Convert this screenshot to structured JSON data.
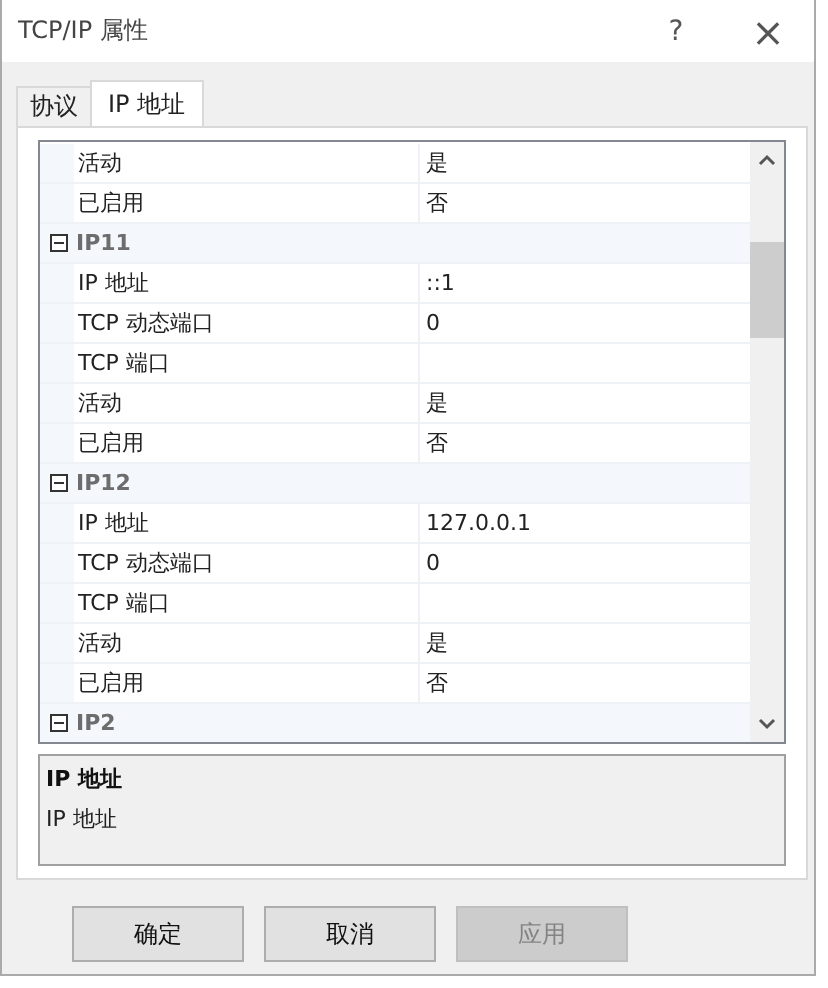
{
  "window": {
    "title": "TCP/IP 属性",
    "help": "?",
    "close": "×"
  },
  "tabs": [
    {
      "label": "协议",
      "selected": false
    },
    {
      "label": "IP 地址",
      "selected": true
    }
  ],
  "property_grid": {
    "groups": [
      {
        "properties": [
          {
            "name": "活动",
            "value": "是"
          },
          {
            "name": "已启用",
            "value": "否"
          }
        ]
      },
      {
        "name": "IP11",
        "expanded": true,
        "properties": [
          {
            "name": "IP 地址",
            "value": "::1"
          },
          {
            "name": "TCP 动态端口",
            "value": "0"
          },
          {
            "name": "TCP 端口"
          },
          {
            "name": "活动",
            "value": "是"
          },
          {
            "name": "已启用",
            "value": "否"
          }
        ]
      },
      {
        "name": "IP12",
        "expanded": true,
        "properties": [
          {
            "name": "IP 地址",
            "value": "127.0.0.1"
          },
          {
            "name": "TCP 动态端口",
            "value": "0"
          },
          {
            "name": "TCP 端口"
          },
          {
            "name": "活动",
            "value": "是"
          },
          {
            "name": "已启用",
            "value": "否"
          }
        ]
      },
      {
        "name": "IP2",
        "expanded": true
      }
    ]
  },
  "description": {
    "title": "IP 地址",
    "text": "IP 地址"
  },
  "buttons": [
    {
      "label": "确定",
      "disabled": false
    },
    {
      "label": "取消",
      "disabled": false
    },
    {
      "label": "应用",
      "disabled": true
    }
  ]
}
